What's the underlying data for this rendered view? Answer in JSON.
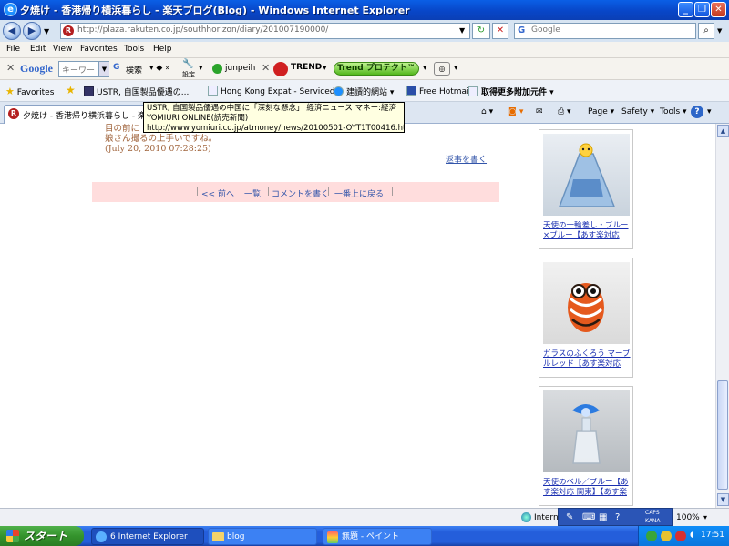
{
  "window": {
    "title": "夕焼け - 香港帰り横浜暮らし - 楽天ブログ(Blog) - Windows Internet Explorer",
    "address": "http://plaza.rakuten.co.jp/southhorizon/diary/201007190000/",
    "search_placeholder": "Google"
  },
  "menu": [
    "File",
    "Edit",
    "View",
    "Favorites",
    "Tools",
    "Help"
  ],
  "google_toolbar": {
    "logo": "Google",
    "input_placeholder": "キーワー",
    "search_label": "検索",
    "settings_label": "設定",
    "user": "junpeih",
    "trend_label": "TREND",
    "trend_protect": "Trend プロテクト™"
  },
  "favorites_bar": {
    "label": "Favorites",
    "items": [
      "USTR, 自国製品優遇の...",
      "Hong Kong Expat - Serviced...",
      "建讀的網站",
      "Free Hotmail",
      "取得更多附加元件"
    ]
  },
  "tab": {
    "title": "夕焼け - 香港帰り横浜暮らし - 楽天",
    "commands": [
      "Page",
      "Safety",
      "Tools"
    ]
  },
  "tooltip": {
    "line1": "USTR, 自国製品優遇の中国に「深刻な懸念」 経済ニュース マネー:経済",
    "line2": "YOMIURI ONLINE(読売新聞)",
    "line3": "http://www.yomiuri.co.jp/atmoney/news/20100501-OYT1T00416.htm?..."
  },
  "content": {
    "comment_line1": "目の前に",
    "comment_line2": "娘さん撮るの上手いですね。",
    "comment_date": "(July 20, 2010 07:28:25)",
    "reply_link": "返事を書く",
    "nav_links": [
      "<< 前へ",
      "一覧",
      "コメントを書く",
      "一番上に戻る"
    ]
  },
  "products": [
    {
      "caption": "天使の一輪差し・ブルー×ブルー【あす楽対応"
    },
    {
      "caption": "ガラスのふくろう マーブルレッド【あす楽対応 …"
    },
    {
      "caption": "天使のベル／ブルー【あす楽対応 関東】【あす楽"
    }
  ],
  "statusbar": {
    "zone": "Intern",
    "zoom": "100%",
    "ime_caps": "CAPS",
    "ime_kana": "KANA"
  },
  "taskbar": {
    "start": "スタート",
    "tasks": [
      "6 Internet Explorer",
      "blog",
      "無題 - ペイント"
    ],
    "clock": "17:51"
  }
}
